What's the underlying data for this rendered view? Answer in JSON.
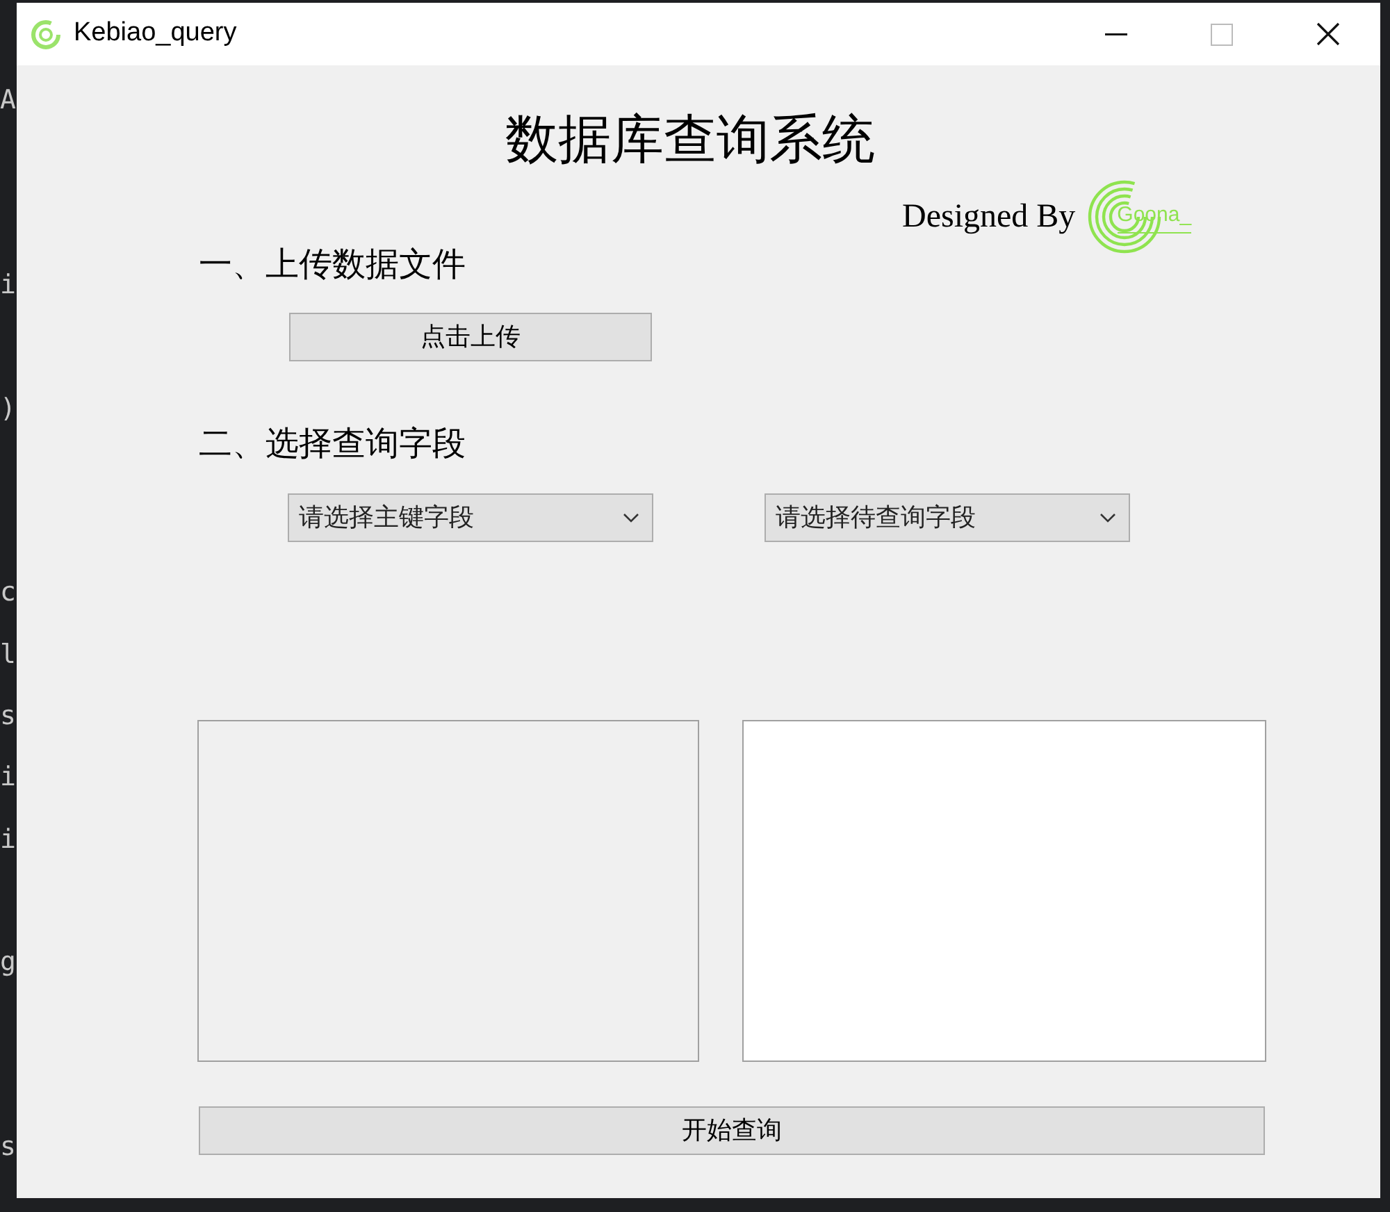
{
  "editor_lines": [
    "A",
    "i",
    ")",
    "c",
    "l",
    "s",
    "i",
    "i",
    "g",
    "s"
  ],
  "window": {
    "title": "Kebiao_query"
  },
  "heading": "数据库查询系统",
  "credit": {
    "label": "Designed By",
    "logo_text": "Goona_"
  },
  "section_1": {
    "label": "一、上传数据文件",
    "upload_button": "点击上传"
  },
  "section_2": {
    "label": "二、选择查询字段",
    "dropdowns": [
      {
        "placeholder": "请选择主键字段"
      },
      {
        "placeholder": "请选择待查询字段"
      }
    ]
  },
  "output_boxes": [
    {
      "kind": "readonly"
    },
    {
      "kind": "editable"
    }
  ],
  "query_button": "开始查询"
}
